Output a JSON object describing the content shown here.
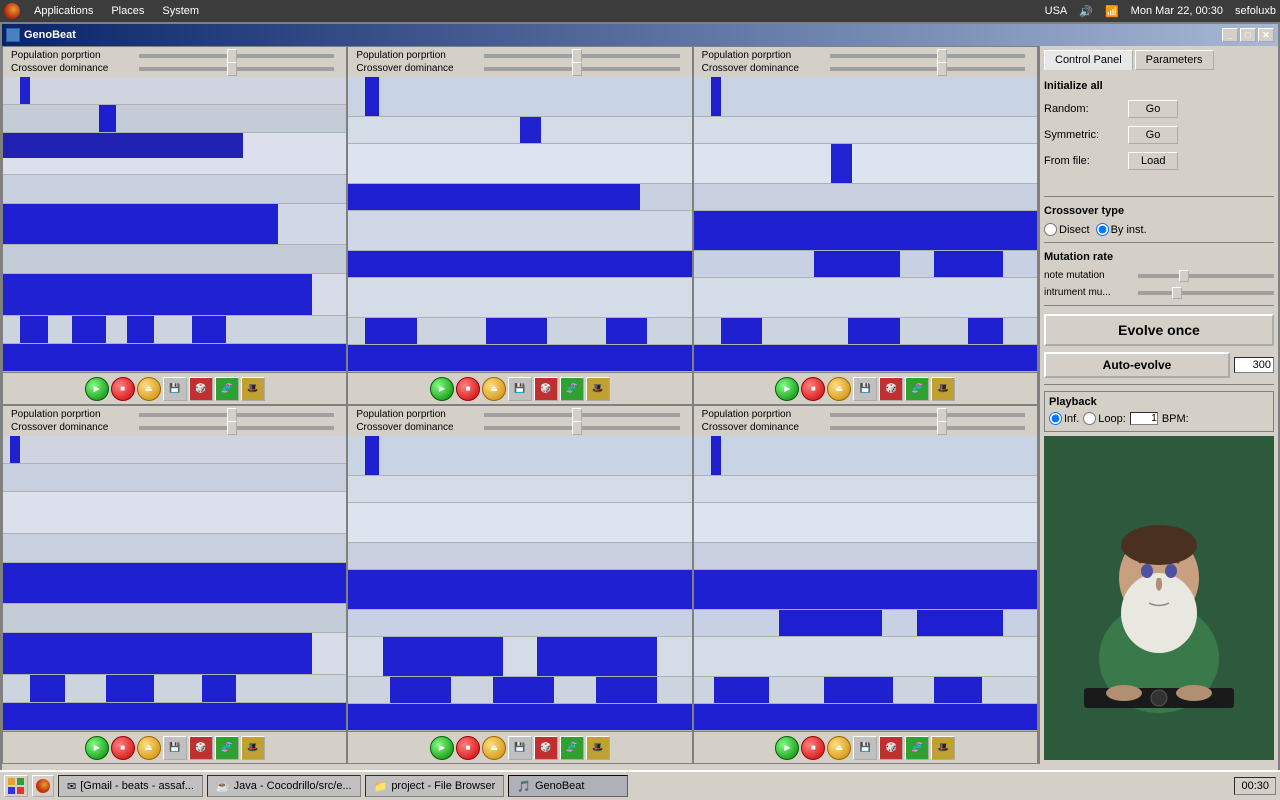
{
  "menubar": {
    "apps": "Applications",
    "places": "Places",
    "system": "System",
    "right": {
      "country": "USA",
      "time": "Mon Mar 22, 00:30",
      "user": "sefoluxb"
    }
  },
  "window": {
    "title": "GenoBeat",
    "icon": "music-icon"
  },
  "panels": [
    {
      "id": "panel-1",
      "pop_label": "Population porprtion",
      "cross_label": "Crossover dominance"
    },
    {
      "id": "panel-2",
      "pop_label": "Population porprtion",
      "cross_label": "Crossover dominance"
    },
    {
      "id": "panel-3",
      "pop_label": "Population porprtion",
      "cross_label": "Crossover dominance"
    },
    {
      "id": "panel-4",
      "pop_label": "Population porprtion",
      "cross_label": "Crossover dominance"
    },
    {
      "id": "panel-5",
      "pop_label": "Population porprtion",
      "cross_label": "Crossover dominance"
    },
    {
      "id": "panel-6",
      "pop_label": "Population porprtion",
      "cross_label": "Crossover dominance"
    }
  ],
  "control_panel": {
    "tab1": "Control Panel",
    "tab2": "Parameters",
    "initialize_all": "Initialize all",
    "random_label": "Random:",
    "symmetric_label": "Symmetric:",
    "from_file_label": "From file:",
    "go_btn": "Go",
    "load_btn": "Load",
    "crossover_type": "Crossover type",
    "disect_label": "Disect",
    "by_inst_label": "By inst.",
    "mutation_rate": "Mutation rate",
    "note_mutation": "note mutation",
    "instr_mutation": "intrument mu...",
    "evolve_once": "Evolve once",
    "auto_evolve": "Auto-evolve",
    "auto_evolve_num": "300",
    "playback": "Playback",
    "inf_label": "Inf.",
    "loop_label": "Loop:",
    "loop_val": "1",
    "bpm_label": "BPM:"
  },
  "taskbar": {
    "items": [
      {
        "label": "[Gmail - beats - assaf...",
        "icon": "email-icon"
      },
      {
        "label": "Java - Cocodrillo/src/e...",
        "icon": "java-icon"
      },
      {
        "label": "project - File Browser",
        "icon": "folder-icon"
      },
      {
        "label": "GenoBeat",
        "icon": "music-icon",
        "active": true
      }
    ]
  }
}
